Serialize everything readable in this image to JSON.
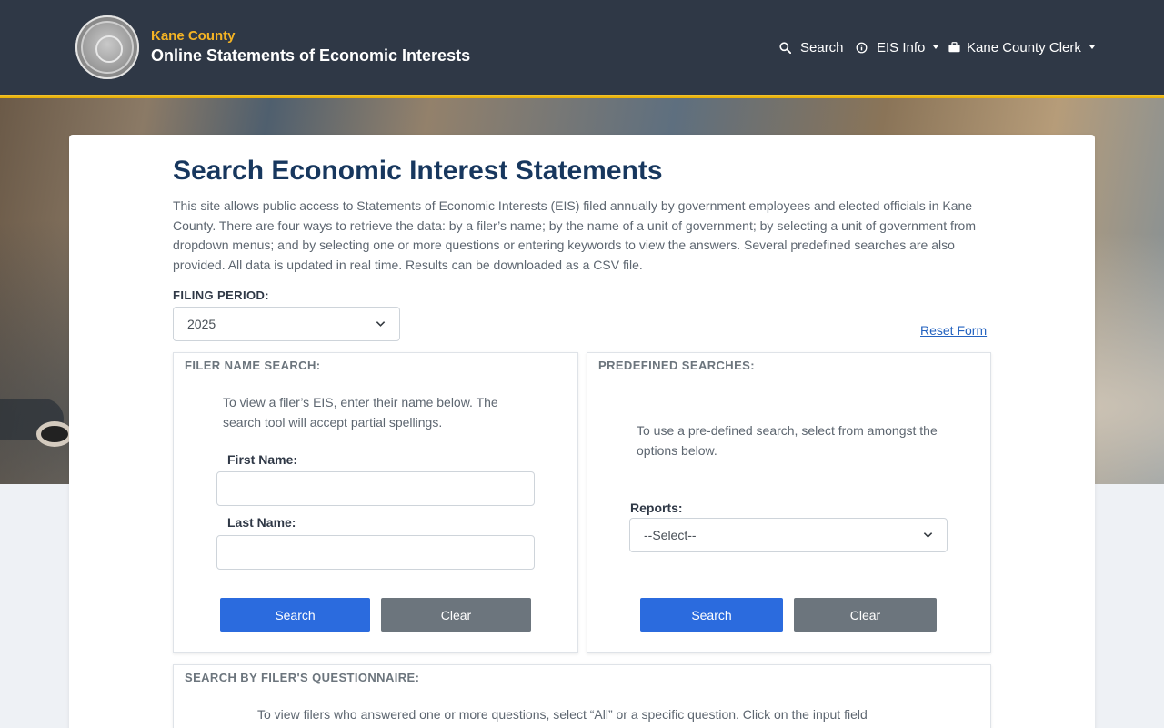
{
  "header": {
    "county": "Kane County",
    "title": "Online Statements of Economic Interests",
    "nav": {
      "search": "Search",
      "eis_info": "EIS Info",
      "clerk": "Kane County Clerk"
    }
  },
  "main": {
    "title": "Search Economic Interest Statements",
    "intro": "This site allows public access to Statements of Economic Interests (EIS) filed annually by government employees and elected officials in Kane County. There are four ways to retrieve the data: by a filer’s name; by the name of a unit of government; by selecting a unit of government from dropdown menus; and by selecting one or more questions or entering keywords to view the answers. Several predefined searches are also provided. All data is updated in real time. Results can be downloaded as a CSV file.",
    "filing_period_label": "FILING PERIOD:",
    "filing_period_value": "2025",
    "reset_form": "Reset Form"
  },
  "filer_search": {
    "title": "FILER NAME SEARCH:",
    "help": "To view a filer’s EIS, enter their name below. The search tool will accept partial spellings.",
    "first_name_label": "First Name:",
    "first_name_value": "",
    "last_name_label": "Last Name:",
    "last_name_value": "",
    "search_label": "Search",
    "clear_label": "Clear"
  },
  "predefined": {
    "title": "PREDEFINED SEARCHES:",
    "help": "To use a pre-defined search, select from amongst the options below.",
    "reports_label": "Reports:",
    "reports_value": "--Select--",
    "search_label": "Search",
    "clear_label": "Clear"
  },
  "questionnaire": {
    "title": "SEARCH BY FILER'S QUESTIONNAIRE:",
    "help": "To view filers who answered one or more questions, select “All” or a specific question. Click on the input field"
  },
  "colors": {
    "header_bg": "#2f3846",
    "accent_gold": "#f4b324",
    "title_navy": "#17375e",
    "primary_button": "#2b6bde",
    "secondary_button": "#6c757d",
    "link": "#2463c0"
  },
  "icons": [
    "county-seal-logo",
    "search-icon",
    "info-icon",
    "briefcase-icon",
    "chevron-down-icon"
  ]
}
